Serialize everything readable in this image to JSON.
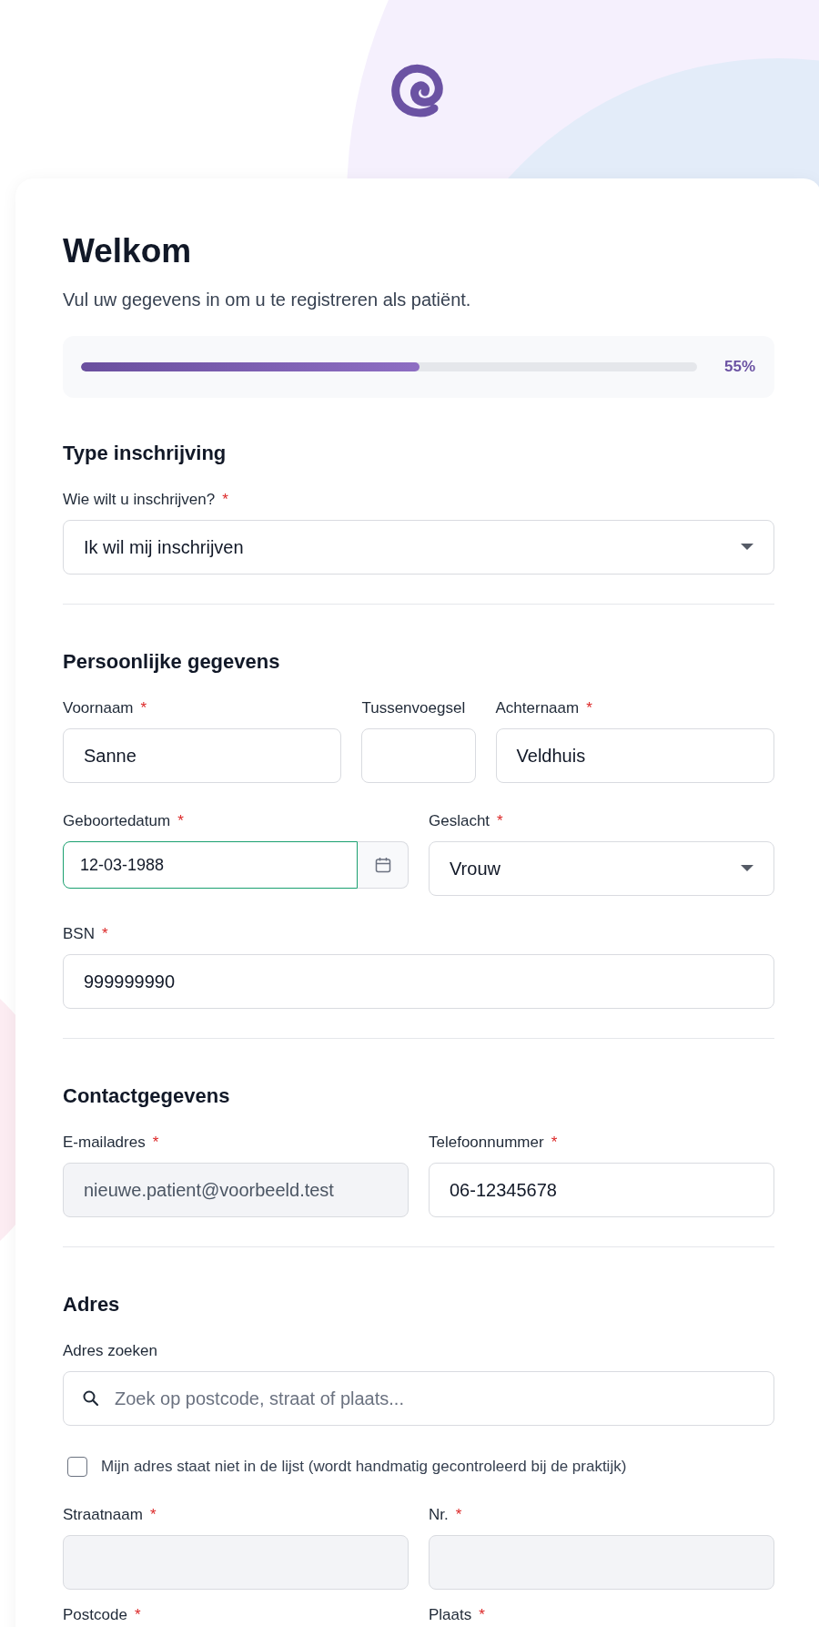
{
  "title": "Welkom",
  "subtitle": "Vul uw gegevens in om u te registreren als patiënt.",
  "progress": {
    "level": 0.55,
    "reading": "55%"
  },
  "sections": [
    {
      "title": "Type inschrijving",
      "rows": [
        {
          "kind": "fields",
          "fields": [
            {
              "label": "Wie wilt u inschrijven?",
              "required_mark": "*",
              "kind": "select",
              "value": "Ik wil mij inschrijven",
              "disabled": false,
              "focused": false
            }
          ]
        }
      ]
    },
    {
      "title": "Persoonlijke gegevens",
      "rows": [
        {
          "kind": "fields",
          "fields": [
            {
              "label": "Voornaam",
              "required_mark": "*",
              "kind": "text",
              "value": "Sanne",
              "disabled": false,
              "focused": false
            },
            {
              "label": "Tussenvoegsel",
              "kind": "text",
              "disabled": false,
              "focused": false
            },
            {
              "label": "Achternaam",
              "required_mark": "*",
              "kind": "text",
              "value": "Veldhuis",
              "disabled": false,
              "focused": false
            }
          ]
        },
        {
          "kind": "fields",
          "fields": [
            {
              "label": "Geboortedatum",
              "required_mark": "*",
              "kind": "date",
              "value": "12-03-1988",
              "disabled": false,
              "focused": true
            },
            {
              "label": "Geslacht",
              "required_mark": "*",
              "kind": "select",
              "value": "Vrouw",
              "disabled": false,
              "focused": false
            }
          ]
        },
        {
          "kind": "fields",
          "fields": [
            {
              "label": "BSN",
              "required_mark": "*",
              "kind": "text",
              "value": "999999990",
              "disabled": false,
              "focused": false
            }
          ]
        }
      ]
    },
    {
      "title": "Contactgegevens",
      "rows": [
        {
          "kind": "fields",
          "fields": [
            {
              "label": "E-mailadres",
              "required_mark": "*",
              "kind": "text",
              "value": "nieuwe.patient@voorbeeld.test",
              "disabled": true,
              "focused": false
            },
            {
              "label": "Telefoonnummer",
              "required_mark": "*",
              "kind": "text",
              "value": "06-12345678",
              "disabled": false,
              "focused": false
            }
          ]
        }
      ]
    },
    {
      "title": "Adres",
      "rows": [
        {
          "kind": "fields",
          "fields": [
            {
              "label": "Adres zoeken",
              "kind": "search",
              "placeholder": "Zoek op postcode, straat of plaats...",
              "disabled": false,
              "focused": false
            }
          ]
        },
        {
          "kind": "checkbox",
          "label": "Mijn adres staat niet in de lijst (wordt handmatig gecontroleerd bij de praktijk)",
          "checked": false
        },
        {
          "kind": "fields",
          "fields": [
            {
              "label": "Straatnaam",
              "required_mark": "*",
              "kind": "text",
              "disabled": true,
              "focused": false
            },
            {
              "label": "Nr.",
              "required_mark": "*",
              "kind": "text",
              "disabled": true,
              "focused": false
            }
          ]
        },
        {
          "kind": "labels",
          "fields": [
            {
              "label": "Postcode",
              "required_mark": "*"
            },
            {
              "label": "Plaats",
              "required_mark": "*"
            }
          ]
        }
      ]
    }
  ]
}
